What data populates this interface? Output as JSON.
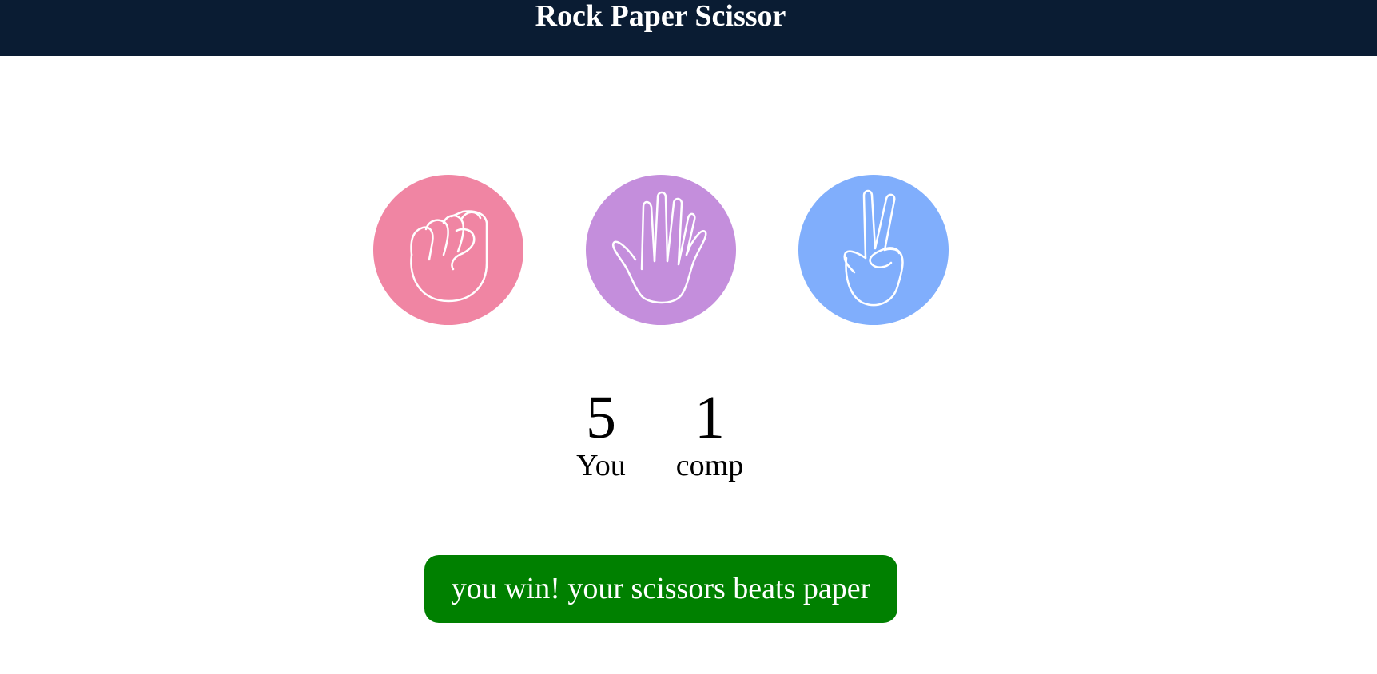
{
  "header": {
    "title": "Rock Paper Scissor"
  },
  "choices": [
    {
      "id": "rock",
      "icon": "fist-icon",
      "color": "#f085a3"
    },
    {
      "id": "paper",
      "icon": "open-hand-icon",
      "color": "#c48edc"
    },
    {
      "id": "scissors",
      "icon": "peace-hand-icon",
      "color": "#80aefc"
    }
  ],
  "scoreboard": {
    "user": {
      "score": "5",
      "label": "You"
    },
    "comp": {
      "score": "1",
      "label": "comp"
    }
  },
  "result": {
    "message": "you win! your scissors beats paper",
    "color": "#008000"
  }
}
